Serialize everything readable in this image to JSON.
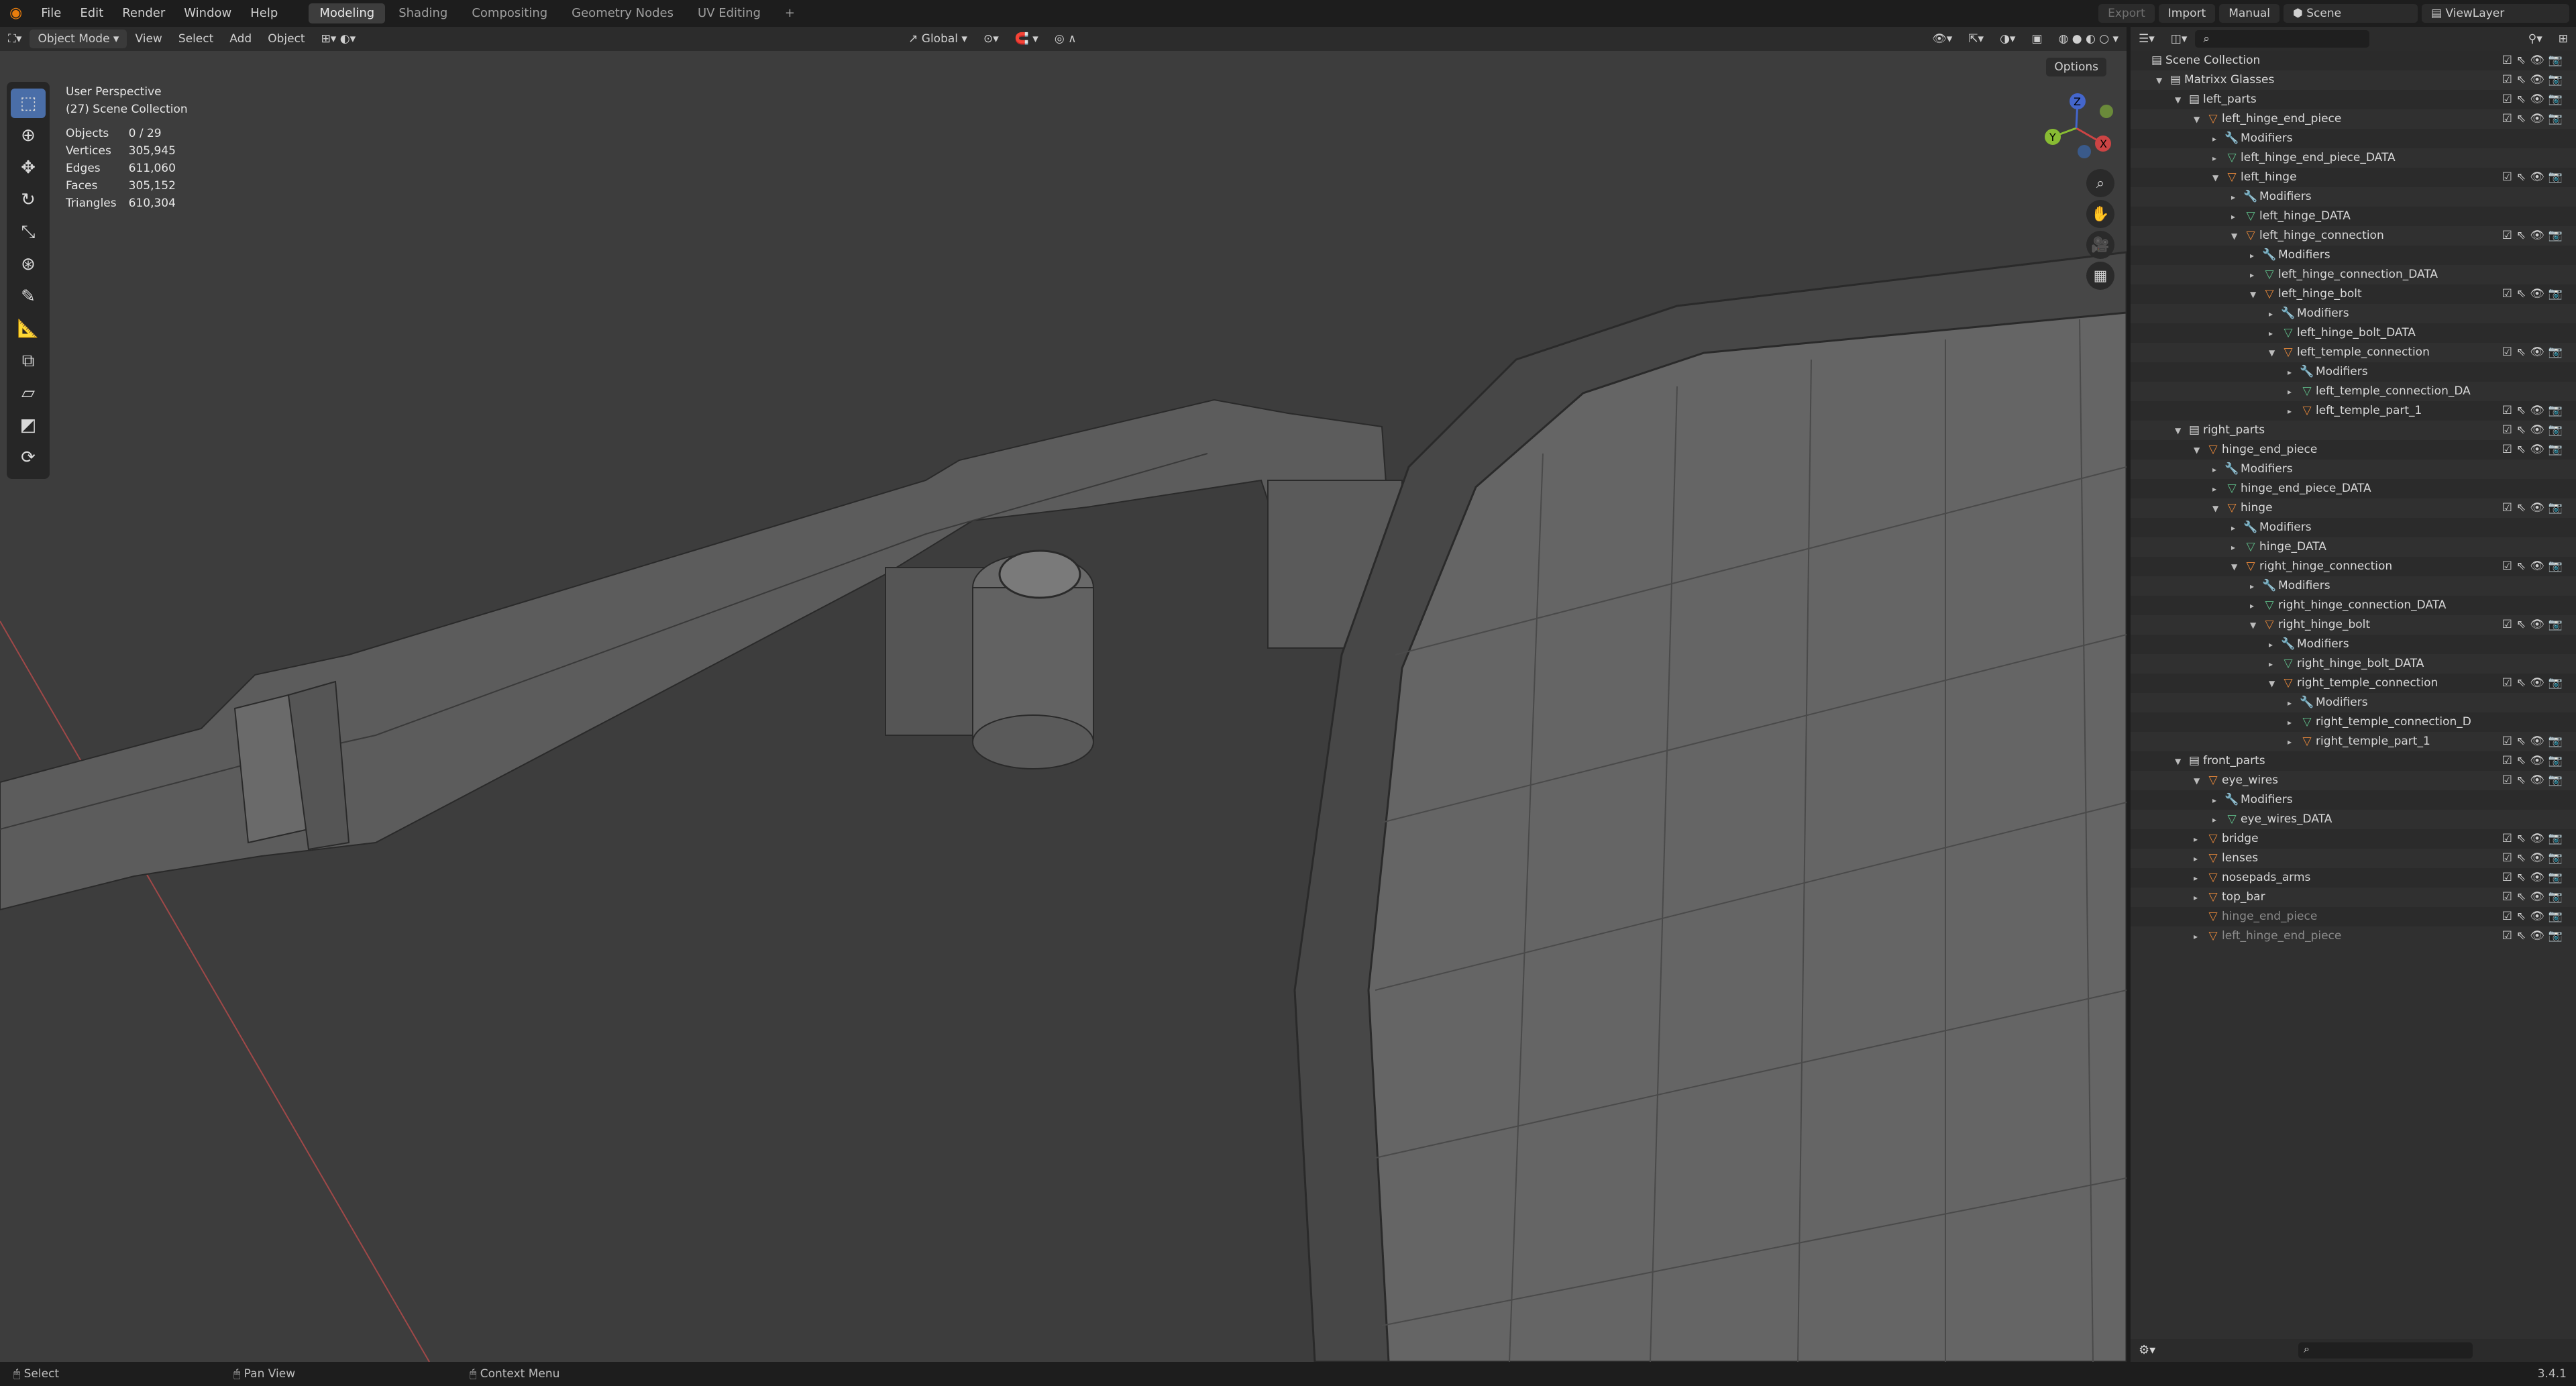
{
  "topbar": {
    "menus": [
      "File",
      "Edit",
      "Render",
      "Window",
      "Help"
    ],
    "workspaces": [
      "Modeling",
      "Shading",
      "Compositing",
      "Geometry Nodes",
      "UV Editing"
    ],
    "active_workspace": "Modeling",
    "plus": "+",
    "export": "Export",
    "import": "Import",
    "manual": "Manual",
    "scene": "Scene",
    "view_layer": "ViewLayer"
  },
  "viewport_header": {
    "mode": "Object Mode",
    "menus": [
      "View",
      "Select",
      "Add",
      "Object"
    ],
    "transform": "Global",
    "options": "Options"
  },
  "overlay": {
    "title": "User Perspective",
    "collection": "(27) Scene Collection",
    "stats": [
      {
        "label": "Objects",
        "value": "0 / 29"
      },
      {
        "label": "Vertices",
        "value": "305,945"
      },
      {
        "label": "Edges",
        "value": "611,060"
      },
      {
        "label": "Faces",
        "value": "305,152"
      },
      {
        "label": "Triangles",
        "value": "610,304"
      }
    ]
  },
  "gizmo": {
    "x": "X",
    "y": "Y",
    "z": "Z"
  },
  "outliner": {
    "rows": [
      {
        "indent": 0,
        "arrow": "",
        "icon": "collection",
        "label": "Scene Collection",
        "dim": false
      },
      {
        "indent": 1,
        "arrow": "▼",
        "icon": "collection",
        "label": "Matrixx Glasses",
        "dim": false
      },
      {
        "indent": 2,
        "arrow": "▼",
        "icon": "collection",
        "label": "left_parts",
        "dim": false
      },
      {
        "indent": 3,
        "arrow": "▼",
        "icon": "object",
        "label": "left_hinge_end_piece",
        "dim": false
      },
      {
        "indent": 4,
        "arrow": "▸",
        "icon": "modifier",
        "label": "Modifiers",
        "dim": false
      },
      {
        "indent": 4,
        "arrow": "▸",
        "icon": "mesh",
        "label": "left_hinge_end_piece_DATA",
        "dim": false
      },
      {
        "indent": 4,
        "arrow": "▼",
        "icon": "object",
        "label": "left_hinge",
        "dim": false
      },
      {
        "indent": 5,
        "arrow": "▸",
        "icon": "modifier",
        "label": "Modifiers",
        "dim": false
      },
      {
        "indent": 5,
        "arrow": "▸",
        "icon": "mesh",
        "label": "left_hinge_DATA",
        "dim": false
      },
      {
        "indent": 5,
        "arrow": "▼",
        "icon": "object",
        "label": "left_hinge_connection",
        "dim": false
      },
      {
        "indent": 6,
        "arrow": "▸",
        "icon": "modifier",
        "label": "Modifiers",
        "dim": false
      },
      {
        "indent": 6,
        "arrow": "▸",
        "icon": "mesh",
        "label": "left_hinge_connection_DATA",
        "dim": false
      },
      {
        "indent": 6,
        "arrow": "▼",
        "icon": "object",
        "label": "left_hinge_bolt",
        "dim": false
      },
      {
        "indent": 7,
        "arrow": "▸",
        "icon": "modifier",
        "label": "Modifiers",
        "dim": false
      },
      {
        "indent": 7,
        "arrow": "▸",
        "icon": "mesh",
        "label": "left_hinge_bolt_DATA",
        "dim": false
      },
      {
        "indent": 7,
        "arrow": "▼",
        "icon": "object",
        "label": "left_temple_connection",
        "dim": false
      },
      {
        "indent": 8,
        "arrow": "▸",
        "icon": "modifier",
        "label": "Modifiers",
        "dim": false
      },
      {
        "indent": 8,
        "arrow": "▸",
        "icon": "mesh",
        "label": "left_temple_connection_DA",
        "dim": false
      },
      {
        "indent": 8,
        "arrow": "▸",
        "icon": "object",
        "label": "left_temple_part_1",
        "dim": false
      },
      {
        "indent": 2,
        "arrow": "▼",
        "icon": "collection",
        "label": "right_parts",
        "dim": false
      },
      {
        "indent": 3,
        "arrow": "▼",
        "icon": "object",
        "label": "hinge_end_piece",
        "dim": false
      },
      {
        "indent": 4,
        "arrow": "▸",
        "icon": "modifier",
        "label": "Modifiers",
        "dim": false
      },
      {
        "indent": 4,
        "arrow": "▸",
        "icon": "mesh",
        "label": "hinge_end_piece_DATA",
        "dim": false
      },
      {
        "indent": 4,
        "arrow": "▼",
        "icon": "object",
        "label": "hinge",
        "dim": false
      },
      {
        "indent": 5,
        "arrow": "▸",
        "icon": "modifier",
        "label": "Modifiers",
        "dim": false
      },
      {
        "indent": 5,
        "arrow": "▸",
        "icon": "mesh",
        "label": "hinge_DATA",
        "dim": false
      },
      {
        "indent": 5,
        "arrow": "▼",
        "icon": "object",
        "label": "right_hinge_connection",
        "dim": false
      },
      {
        "indent": 6,
        "arrow": "▸",
        "icon": "modifier",
        "label": "Modifiers",
        "dim": false
      },
      {
        "indent": 6,
        "arrow": "▸",
        "icon": "mesh",
        "label": "right_hinge_connection_DATA",
        "dim": false
      },
      {
        "indent": 6,
        "arrow": "▼",
        "icon": "object",
        "label": "right_hinge_bolt",
        "dim": false
      },
      {
        "indent": 7,
        "arrow": "▸",
        "icon": "modifier",
        "label": "Modifiers",
        "dim": false
      },
      {
        "indent": 7,
        "arrow": "▸",
        "icon": "mesh",
        "label": "right_hinge_bolt_DATA",
        "dim": false
      },
      {
        "indent": 7,
        "arrow": "▼",
        "icon": "object",
        "label": "right_temple_connection",
        "dim": false
      },
      {
        "indent": 8,
        "arrow": "▸",
        "icon": "modifier",
        "label": "Modifiers",
        "dim": false
      },
      {
        "indent": 8,
        "arrow": "▸",
        "icon": "mesh",
        "label": "right_temple_connection_D",
        "dim": false
      },
      {
        "indent": 8,
        "arrow": "▸",
        "icon": "object",
        "label": "right_temple_part_1",
        "dim": false
      },
      {
        "indent": 2,
        "arrow": "▼",
        "icon": "collection",
        "label": "front_parts",
        "dim": false
      },
      {
        "indent": 3,
        "arrow": "▼",
        "icon": "object",
        "label": "eye_wires",
        "dim": false
      },
      {
        "indent": 4,
        "arrow": "▸",
        "icon": "modifier",
        "label": "Modifiers",
        "dim": false
      },
      {
        "indent": 4,
        "arrow": "▸",
        "icon": "mesh",
        "label": "eye_wires_DATA",
        "dim": false
      },
      {
        "indent": 3,
        "arrow": "▸",
        "icon": "object",
        "label": "bridge",
        "dim": false
      },
      {
        "indent": 3,
        "arrow": "▸",
        "icon": "object",
        "label": "lenses",
        "dim": false
      },
      {
        "indent": 3,
        "arrow": "▸",
        "icon": "object",
        "label": "nosepads_arms",
        "dim": false
      },
      {
        "indent": 3,
        "arrow": "▸",
        "icon": "object",
        "label": "top_bar",
        "dim": false
      },
      {
        "indent": 3,
        "arrow": "",
        "icon": "object",
        "label": "hinge_end_piece",
        "dim": true
      },
      {
        "indent": 3,
        "arrow": "▸",
        "icon": "object",
        "label": "left_hinge_end_piece",
        "dim": true
      }
    ]
  },
  "status_bar": {
    "select": "Select",
    "pan": "Pan View",
    "context": "Context Menu",
    "version": "3.4.1"
  }
}
